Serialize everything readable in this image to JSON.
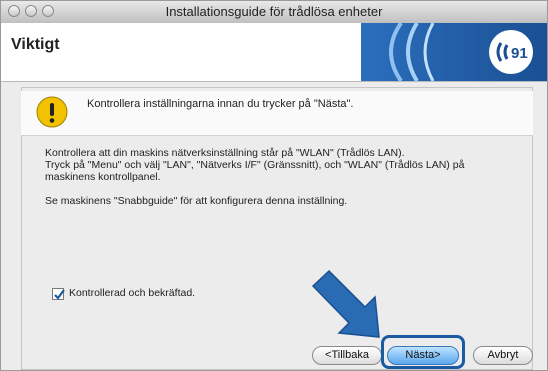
{
  "window": {
    "title": "Installationsguide för trådlösa enheter"
  },
  "header": {
    "title": "Viktigt"
  },
  "warning": {
    "text": "Kontrollera inställningarna innan du trycker på \"Nästa\"."
  },
  "body": {
    "p1_line1": "Kontrollera att din maskins nätverksinställning står på \"WLAN\" (Trådlös LAN).",
    "p1_line2": "Tryck på \"Menu\" och välj \"LAN\", \"Nätverks I/F\" (Gränssnitt), och \"WLAN\" (Trådlös LAN) på",
    "p1_line3": "maskinens kontrollpanel.",
    "p2": "Se maskinens \"Snabbguide\" för att konfigurera denna inställning."
  },
  "checkbox": {
    "label": "Kontrollerad och bekräftad.",
    "checked": true
  },
  "buttons": {
    "back": "<Tillbaka",
    "next": "Nästa>",
    "cancel": "Avbryt"
  },
  "colors": {
    "accent_blue": "#1a5aa0",
    "arrow_blue": "#2a6cb4",
    "warning_yellow": "#f2c200"
  },
  "icons": {
    "banner": "wireless-icon",
    "warning": "warning-icon",
    "arrow": "pointer-arrow-icon"
  }
}
